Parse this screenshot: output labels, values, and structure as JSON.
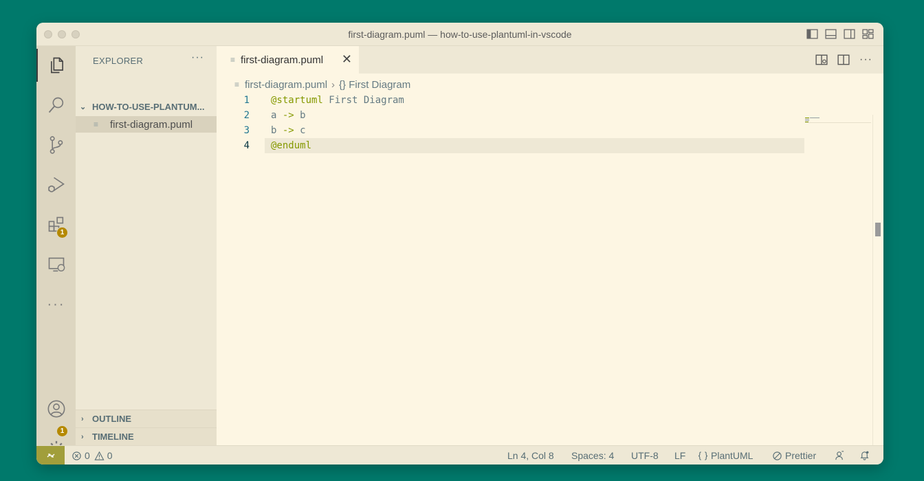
{
  "window": {
    "title": "first-diagram.puml — how-to-use-plantuml-in-vscode"
  },
  "activity": {
    "extensions_badge": "1",
    "settings_badge": "1"
  },
  "sidebar": {
    "header": "EXPLORER",
    "more": "···",
    "folder": "HOW-TO-USE-PLANTUM...",
    "file": "first-diagram.puml",
    "sections": [
      "OUTLINE",
      "TIMELINE"
    ]
  },
  "editor": {
    "tab_label": "first-diagram.puml",
    "more": "···",
    "breadcrumb": {
      "file": "first-diagram.puml",
      "symbol": "{} First Diagram"
    },
    "lines": [
      {
        "num": "1",
        "kw": "@startuml",
        "rest": " First Diagram"
      },
      {
        "num": "2",
        "pre": "a ",
        "op": "->",
        "post": " b"
      },
      {
        "num": "3",
        "pre": "b ",
        "op": "->",
        "post": " c"
      },
      {
        "num": "4",
        "kw": "@enduml",
        "rest": ""
      }
    ]
  },
  "status": {
    "errors": "0",
    "warnings": "0",
    "position": "Ln 4, Col 8",
    "spaces": "Spaces: 4",
    "encoding": "UTF-8",
    "eol": "LF",
    "language": "PlantUML",
    "formatter": "Prettier"
  },
  "colors": {
    "accent": "#b58900",
    "keyword": "#859900",
    "remote": "#a19e3b",
    "background": "#00796b"
  }
}
